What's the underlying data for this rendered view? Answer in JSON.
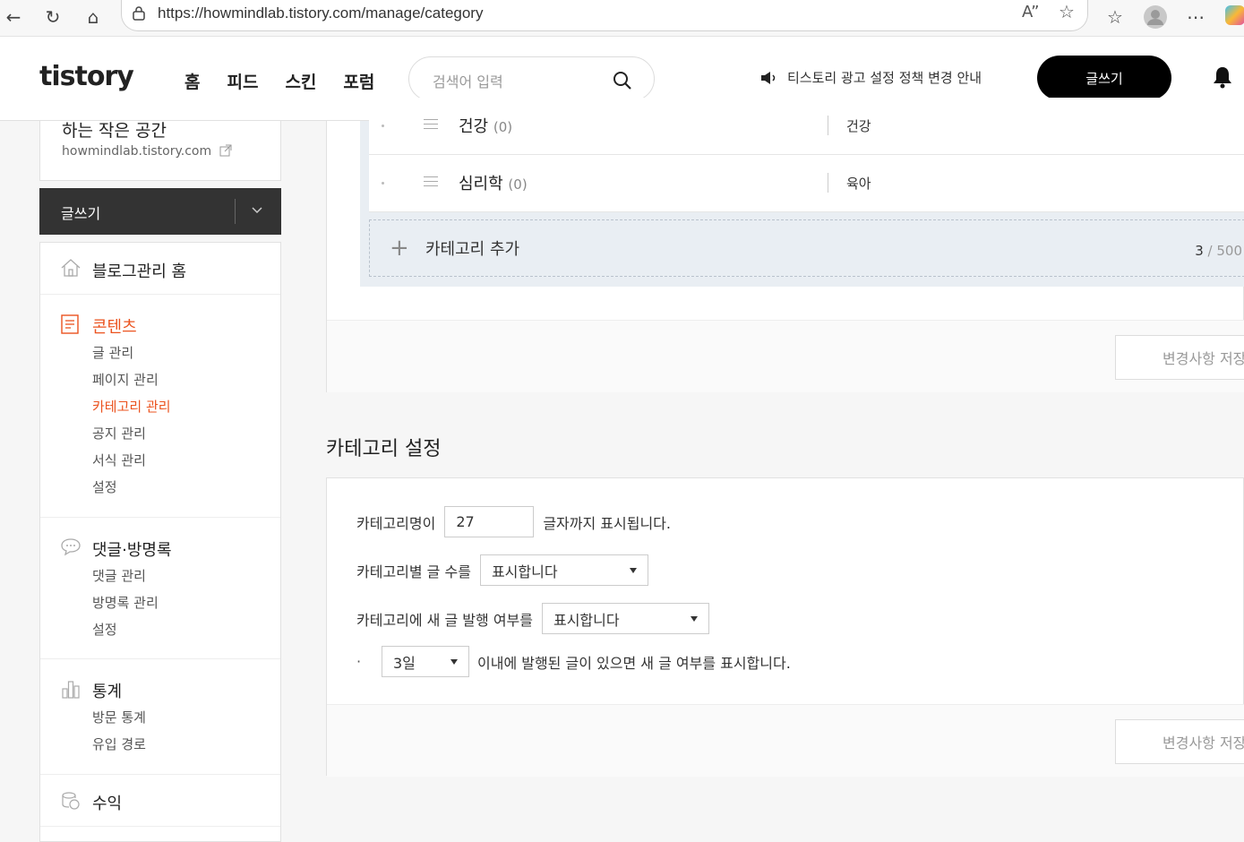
{
  "browser": {
    "url": "https://howmindlab.tistory.com/manage/category"
  },
  "header": {
    "logo": "tistory",
    "nav": [
      "홈",
      "피드",
      "스킨",
      "포럼"
    ],
    "search_placeholder": "검색어 입력",
    "notice": "티스토리 광고 설정 정책 변경 안내",
    "write_button": "글쓰기"
  },
  "sidebar": {
    "blog_title": "하는 작은 공간",
    "blog_url": "howmindlab.tistory.com",
    "write_button": "글쓰기",
    "home": "블로그관리 홈",
    "contents": {
      "title": "콘텐츠",
      "items": [
        "글 관리",
        "페이지 관리",
        "카테고리 관리",
        "공지 관리",
        "서식 관리",
        "설정"
      ]
    },
    "comments": {
      "title": "댓글·방명록",
      "items": [
        "댓글 관리",
        "방명록 관리",
        "설정"
      ]
    },
    "stats": {
      "title": "통계",
      "items": [
        "방문 통계",
        "유입 경로"
      ]
    },
    "revenue": {
      "title": "수익"
    }
  },
  "categories": {
    "rows": [
      {
        "name": "건강",
        "count": "(0)",
        "desc": "건강"
      },
      {
        "name": "심리학",
        "count": "(0)",
        "desc": "육아"
      }
    ],
    "add_label": "카테고리 추가",
    "count_current": "3",
    "count_max": "500",
    "save_button": "변경사항 저장"
  },
  "settings": {
    "title": "카테고리 설정",
    "name_label": "카테고리명이",
    "name_value": "27",
    "name_suffix": "글자까지 표시됩니다.",
    "count_label": "카테고리별 글 수를",
    "count_select": "표시합니다",
    "new_label": "카테고리에 새 글 발행 여부를",
    "new_select": "표시합니다",
    "days_bullet": "·",
    "days_select": "3일",
    "days_suffix": "이내에 발행된 글이 있으면 새 글 여부를 표시합니다.",
    "save_button": "변경사항 저장"
  },
  "colors": {
    "accent": "#eb531f",
    "dark": "#333333"
  }
}
